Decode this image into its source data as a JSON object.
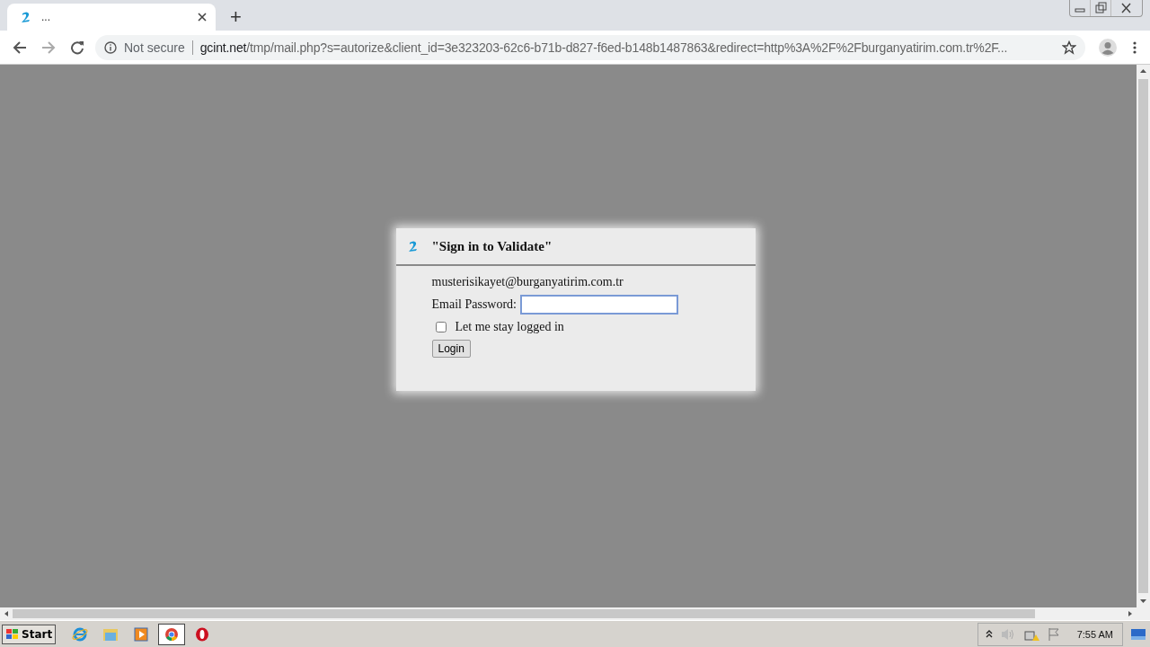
{
  "browser": {
    "tab": {
      "title": "...",
      "selected": true
    },
    "new_tab": "+",
    "security": "Not secure",
    "url": {
      "host": "gcint.net",
      "path": "/tmp/mail.php?s=autorize&client_id=3e323203-62c6-b71b-d827-f6ed-b148b1487863&redirect=http%3A%2F%2Fburganyatirim.com.tr%2F..."
    }
  },
  "dialog": {
    "title": "\"Sign in to Validate\"",
    "email": "musterisikayet@burganyatirim.com.tr",
    "password_label": "Email Password:",
    "password_focused": true,
    "remember": {
      "label": "Let me stay logged in",
      "checked": false
    },
    "button": "Login"
  },
  "taskbar": {
    "start": "Start",
    "apps": [
      {
        "kind": "ie",
        "selected": false
      },
      {
        "kind": "folder",
        "selected": false
      },
      {
        "kind": "media",
        "selected": false
      },
      {
        "kind": "chrome",
        "selected": true
      },
      {
        "kind": "opera",
        "selected": false
      }
    ],
    "clock": "7:55 AM"
  }
}
